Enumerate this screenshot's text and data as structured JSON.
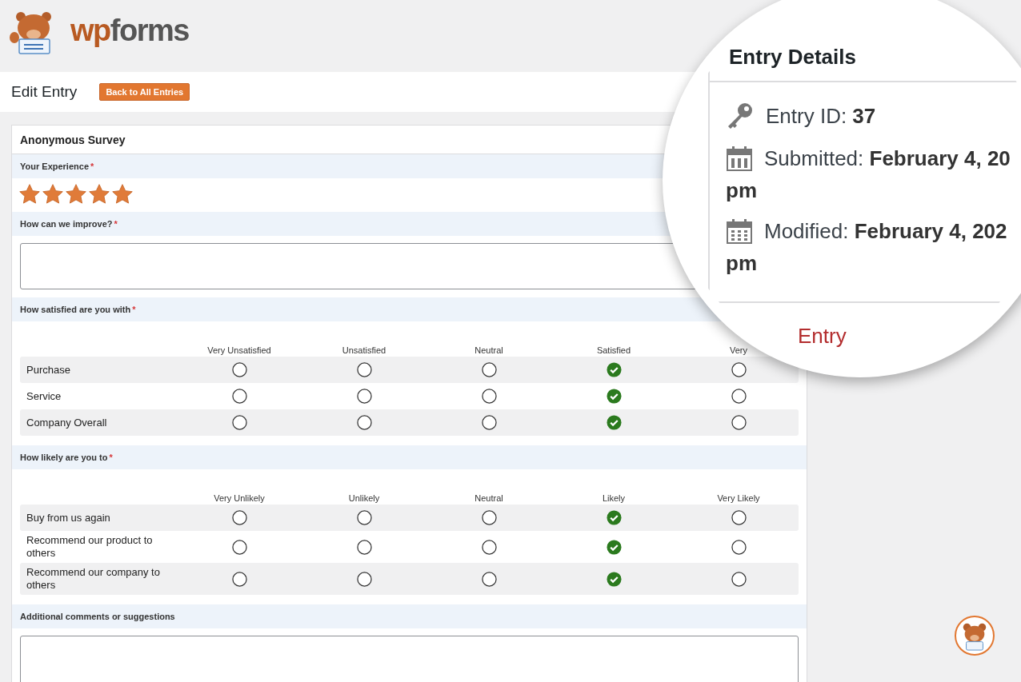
{
  "logo": {
    "parts": [
      "wp",
      "forms"
    ]
  },
  "page_header": {
    "title": "Edit Entry",
    "button": "Back to All Entries"
  },
  "form": {
    "title": "Anonymous Survey",
    "required_mark": "*",
    "fields": [
      {
        "kind": "rating",
        "label": "Your Experience",
        "required": true,
        "stars": 5
      },
      {
        "kind": "textarea",
        "label": "How can we improve?",
        "required": true
      },
      {
        "kind": "likert",
        "label": "How satisfied are you with",
        "required": true,
        "columns": [
          "Very Unsatisfied",
          "Unsatisfied",
          "Neutral",
          "Satisfied",
          "Very"
        ],
        "rows": [
          {
            "label": "Purchase",
            "options": [
              {
                "selected": false
              },
              {
                "selected": false
              },
              {
                "selected": false
              },
              {
                "selected": true
              },
              {
                "selected": false
              }
            ]
          },
          {
            "label": "Service",
            "options": [
              {
                "selected": false
              },
              {
                "selected": false
              },
              {
                "selected": false
              },
              {
                "selected": true
              },
              {
                "selected": false
              }
            ]
          },
          {
            "label": "Company Overall",
            "options": [
              {
                "selected": false
              },
              {
                "selected": false
              },
              {
                "selected": false
              },
              {
                "selected": true
              },
              {
                "selected": false
              }
            ]
          }
        ]
      },
      {
        "kind": "likert",
        "label": "How likely are you to",
        "required": true,
        "columns": [
          "Very Unlikely",
          "Unlikely",
          "Neutral",
          "Likely",
          "Very Likely"
        ],
        "rows": [
          {
            "label": "Buy from us again",
            "options": [
              {
                "selected": false
              },
              {
                "selected": false
              },
              {
                "selected": false
              },
              {
                "selected": true
              },
              {
                "selected": false
              }
            ]
          },
          {
            "label": "Recommend our product to others",
            "options": [
              {
                "selected": false
              },
              {
                "selected": false
              },
              {
                "selected": false
              },
              {
                "selected": true
              },
              {
                "selected": false
              }
            ]
          },
          {
            "label": "Recommend our company to others",
            "options": [
              {
                "selected": false
              },
              {
                "selected": false
              },
              {
                "selected": false
              },
              {
                "selected": true
              },
              {
                "selected": false
              }
            ]
          }
        ]
      },
      {
        "kind": "textarea",
        "label": "Additional comments or suggestions"
      }
    ]
  },
  "entry_details": {
    "title": "Entry Details",
    "items": [
      {
        "kind": "id",
        "label": "Entry ID:",
        "value": "37"
      },
      {
        "kind": "submitted",
        "label": "Submitted:",
        "value": "February 4, 20",
        "value_line_2": "pm"
      },
      {
        "kind": "modified",
        "label": "Modified:",
        "value": "February 4, 202",
        "value_line_2": "pm"
      }
    ],
    "action": "Entry"
  }
}
